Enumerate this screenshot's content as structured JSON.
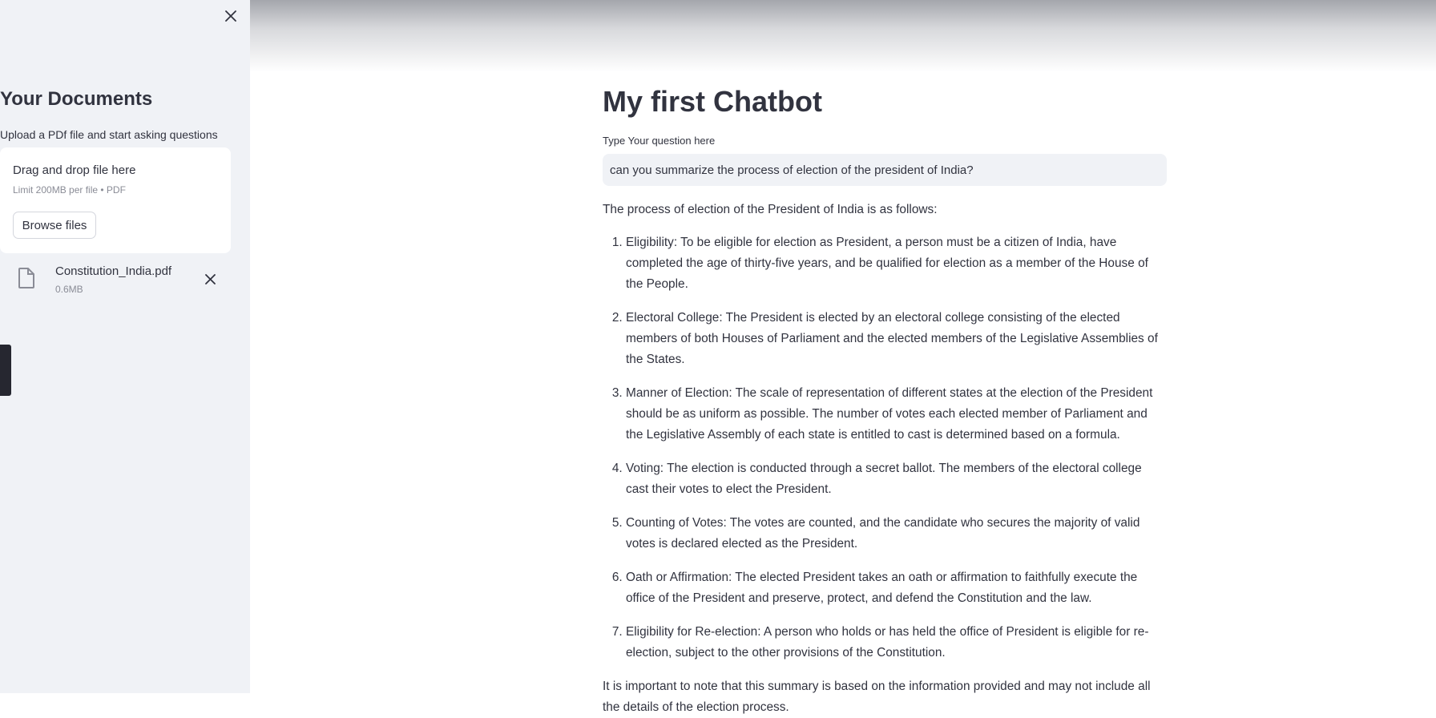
{
  "sidebar": {
    "close_icon": "close-icon",
    "title": "Your Documents",
    "subtitle": "Upload a PDf file and start asking questions",
    "dropzone": {
      "title": "Drag and drop file here",
      "limit": "Limit 200MB per file • PDF",
      "browse_label": "Browse files"
    },
    "uploaded_file": {
      "icon": "file-icon",
      "name": "Constitution_India.pdf",
      "size": "0.6MB",
      "remove_icon": "close-icon"
    }
  },
  "main": {
    "title": "My first Chatbot",
    "question_label": "Type Your question here",
    "question_value": "can you summarize the process of election of the president of India?",
    "answer": {
      "intro": "The process of election of the President of India is as follows:",
      "items": [
        "Eligibility: To be eligible for election as President, a person must be a citizen of India, have completed the age of thirty-five years, and be qualified for election as a member of the House of the People.",
        "Electoral College: The President is elected by an electoral college consisting of the elected members of both Houses of Parliament and the elected members of the Legislative Assemblies of the States.",
        "Manner of Election: The scale of representation of different states at the election of the President should be as uniform as possible. The number of votes each elected member of Parliament and the Legislative Assembly of each state is entitled to cast is determined based on a formula.",
        "Voting: The election is conducted through a secret ballot. The members of the electoral college cast their votes to elect the President.",
        "Counting of Votes: The votes are counted, and the candidate who secures the majority of valid votes is declared elected as the President.",
        "Oath or Affirmation: The elected President takes an oath or affirmation to faithfully execute the office of the President and preserve, protect, and defend the Constitution and the law.",
        "Eligibility for Re-election: A person who holds or has held the office of President is eligible for re-election, subject to the other provisions of the Constitution."
      ],
      "outro": "It is important to note that this summary is based on the information provided and may not include all the details of the election process."
    }
  },
  "colors": {
    "sidebar_bg": "#f0f2f6",
    "text": "#31333f",
    "muted_text": "#8a8c96",
    "input_bg": "#f0f2f6"
  }
}
